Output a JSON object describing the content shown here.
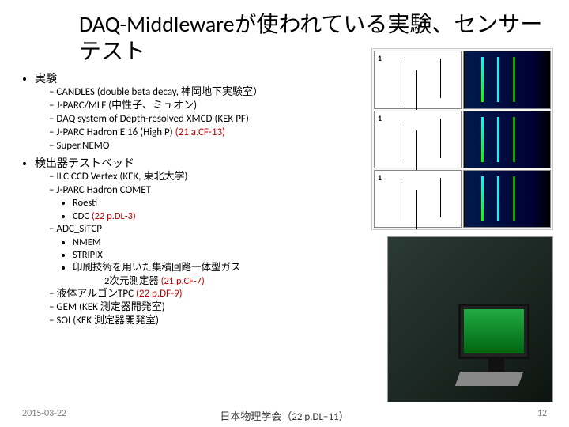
{
  "title": "DAQ-Middlewareが使われている実験、センサーテスト",
  "sec1": {
    "head": "実験",
    "items": [
      "CANDLES  (double beta decay, 神岡地下実験室）",
      "J-PARC/MLF (中性子、ミュオン)",
      "DAQ system of Depth-resolved XMCD (KEK PF)",
      {
        "t": "J-PARC Hadron E 16 (High P) ",
        "r": "(21 a.CF-13)"
      },
      "Super.NEMO"
    ]
  },
  "sec2": {
    "head": "検出器テストベッド",
    "i0": "ILC CCD Vertex (KEK, 東北大学)",
    "i1": "J-PARC Hadron COMET",
    "i1a": "Roesti",
    "i1b": {
      "t": "CDC ",
      "r": "(22 p.DL-3)"
    },
    "i2": "ADC_SiTCP",
    "i2a": "NMEM",
    "i2b": "STRIPIX",
    "i2c": "印刷技術を用いた集積回路一体型ガス",
    "i2c2": {
      "t": "2次元測定器 ",
      "r": "(21 p.CF-7)"
    },
    "i3": {
      "t": "液体アルゴンTPC ",
      "r": "(22 p.DF-9)"
    },
    "i4": "GEM (KEK 測定器開発室)",
    "i5": "SOI (KEK 測定器開発室)"
  },
  "footer": {
    "date": "2015-03-22",
    "center": "日本物理学会（22 p.DL−11）",
    "page": "12"
  }
}
